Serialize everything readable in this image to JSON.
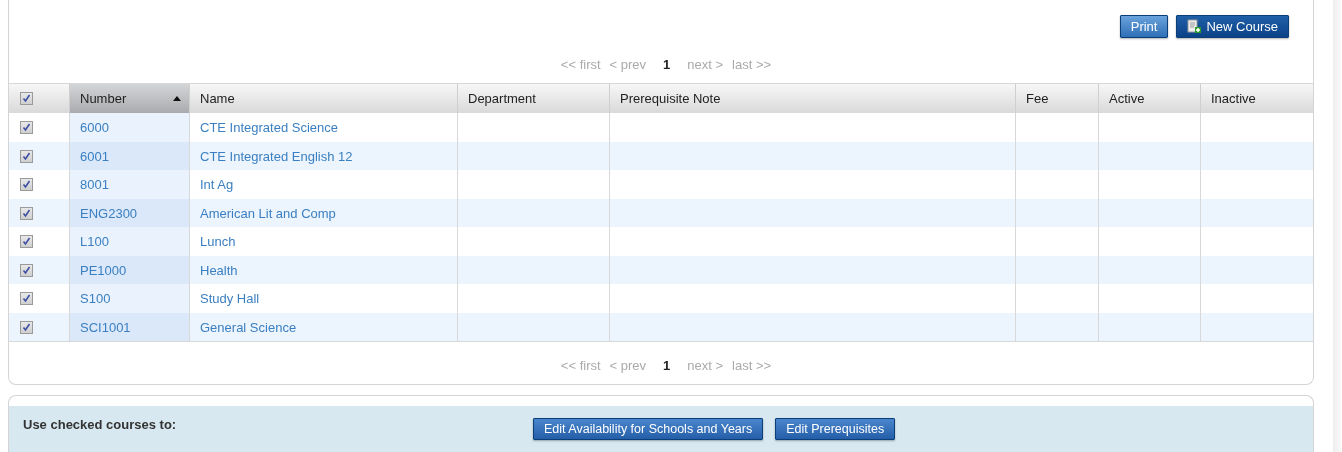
{
  "toolbar": {
    "buttons": [
      {
        "label": "Print",
        "kind": "plain"
      },
      {
        "label": "New Course",
        "kind": "add"
      }
    ]
  },
  "pager_top": [
    {
      "label": "<< first",
      "selected": false
    },
    {
      "label": "< prev",
      "selected": false
    },
    {
      "label": "1",
      "selected": true
    },
    {
      "label": "next >",
      "selected": false
    },
    {
      "label": "last >>",
      "selected": false
    }
  ],
  "table": {
    "select_all": {
      "checked": true
    },
    "columns": [
      {
        "label": "Number",
        "sorted": true
      },
      {
        "label": "Name",
        "sorted": false
      },
      {
        "label": "Department",
        "sorted": false
      },
      {
        "label": "Prerequisite Note",
        "sorted": false
      },
      {
        "label": "Fee",
        "sorted": false
      },
      {
        "label": "Active",
        "sorted": false
      },
      {
        "label": "Inactive",
        "sorted": false
      }
    ],
    "rows": [
      {
        "checked": true,
        "number": "6000",
        "name": "CTE Integrated Science"
      },
      {
        "checked": true,
        "number": "6001",
        "name": "CTE Integrated English 12"
      },
      {
        "checked": true,
        "number": "8001",
        "name": "Int Ag"
      },
      {
        "checked": true,
        "number": "ENG2300",
        "name": "American Lit and Comp"
      },
      {
        "checked": true,
        "number": "L100",
        "name": "Lunch"
      },
      {
        "checked": true,
        "number": "PE1000",
        "name": "Health"
      },
      {
        "checked": true,
        "number": "S100",
        "name": "Study Hall"
      },
      {
        "checked": true,
        "number": "SCI1001",
        "name": "General Science"
      }
    ]
  },
  "pager_bottom": [
    {
      "label": "<< first",
      "selected": false
    },
    {
      "label": "< prev",
      "selected": false
    },
    {
      "label": "1",
      "selected": true
    },
    {
      "label": "next >",
      "selected": false
    },
    {
      "label": "last >>",
      "selected": false
    }
  ],
  "bulk_actions": {
    "label": "Use checked courses to:",
    "buttons": [
      "Edit Availability for Schools and Years",
      "Edit Prerequisites"
    ]
  }
}
